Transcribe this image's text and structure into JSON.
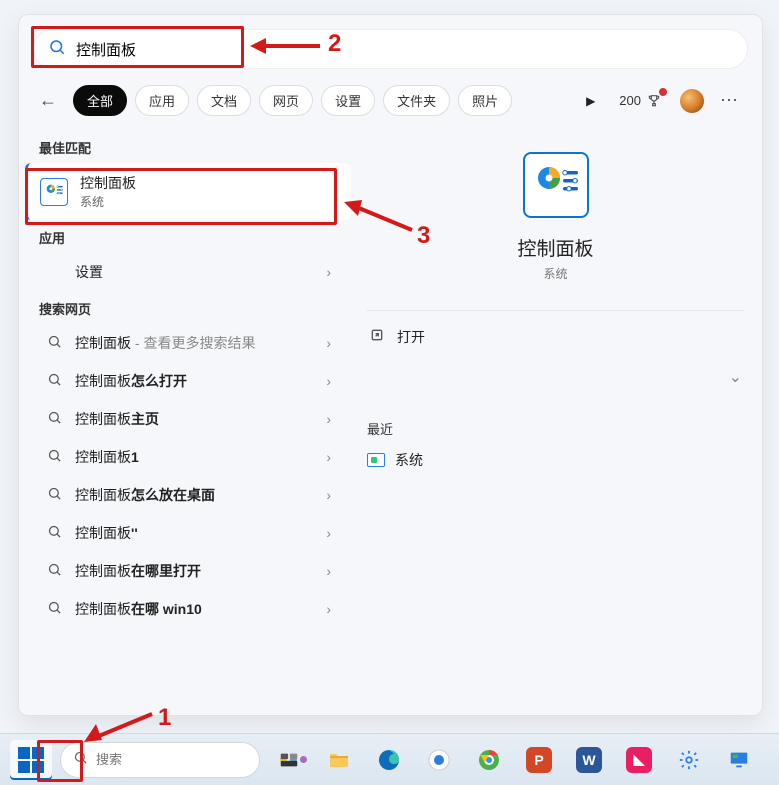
{
  "search": {
    "value": "控制面板"
  },
  "tabs": [
    "全部",
    "应用",
    "文档",
    "网页",
    "设置",
    "文件夹",
    "照片"
  ],
  "active_tab_index": 0,
  "points": "200",
  "sections": {
    "best_match_header": "最佳匹配",
    "apps_header": "应用",
    "web_header": "搜索网页"
  },
  "best_match": {
    "title": "控制面板",
    "subtitle": "系统"
  },
  "apps": [
    {
      "label": "设置"
    }
  ],
  "web_results": [
    {
      "prefix": "控制面板",
      "bold": "",
      "suffix": " - 查看更多搜索结果"
    },
    {
      "prefix": "控制面板",
      "bold": "怎么打开",
      "suffix": ""
    },
    {
      "prefix": "控制面板",
      "bold": "主页",
      "suffix": ""
    },
    {
      "prefix": "控制面板",
      "bold": "1",
      "suffix": ""
    },
    {
      "prefix": "控制面板",
      "bold": "怎么放在桌面",
      "suffix": ""
    },
    {
      "prefix": "控制面板",
      "bold": "''",
      "suffix": ""
    },
    {
      "prefix": "控制面板",
      "bold": "在哪里打开",
      "suffix": ""
    },
    {
      "prefix": "控制面板",
      "bold": "在哪 win10",
      "suffix": ""
    }
  ],
  "preview": {
    "title": "控制面板",
    "subtitle": "系统",
    "open_label": "打开",
    "recent_header": "最近",
    "recent_items": [
      {
        "label": "系统"
      }
    ]
  },
  "taskbar": {
    "search_placeholder": "搜索"
  },
  "annotations": {
    "n1": "1",
    "n2": "2",
    "n3": "3"
  }
}
